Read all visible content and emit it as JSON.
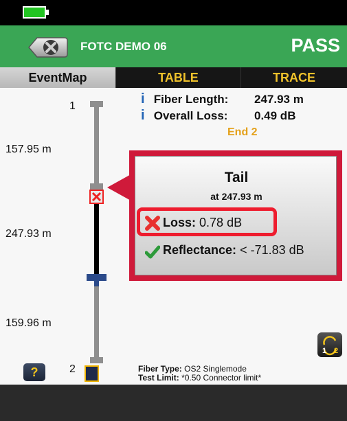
{
  "header": {
    "test_name": "FOTC DEMO 06",
    "status": "PASS"
  },
  "tabs": [
    {
      "label": "EventMap",
      "active": true
    },
    {
      "label": "TABLE",
      "active": false
    },
    {
      "label": "TRACE",
      "active": false
    }
  ],
  "summary": {
    "fiber_length_label": "Fiber Length:",
    "fiber_length_value": "247.93 m",
    "overall_loss_label": "Overall Loss:",
    "overall_loss_value": "0.49 dB",
    "end_label": "End 2"
  },
  "event_map": {
    "start_event": "1",
    "end_event": "2",
    "distances": [
      "157.95 m",
      "247.93 m",
      "159.96 m"
    ]
  },
  "popup": {
    "title": "Tail",
    "subtitle": "at 247.93 m",
    "loss_label": "Loss:",
    "loss_value": "0.78 dB",
    "loss_status_icon": "fail-x-icon",
    "reflectance_label": "Reflectance:",
    "reflectance_value": "< -71.83 dB",
    "reflectance_status_icon": "pass-check-icon"
  },
  "footer_info": {
    "fiber_type_label": "Fiber Type:",
    "fiber_type_value": "OS2 Singlemode",
    "test_limit_label": "Test Limit:",
    "test_limit_value": "*0.50 Connector limit*"
  },
  "buttons": {
    "help": "?"
  },
  "colors": {
    "header_green": "#3aa655",
    "pass_text": "#ffffff",
    "alert_red": "#cf1a3a",
    "end_label": "#e4a11b",
    "tab_text": "#f0c22b"
  }
}
